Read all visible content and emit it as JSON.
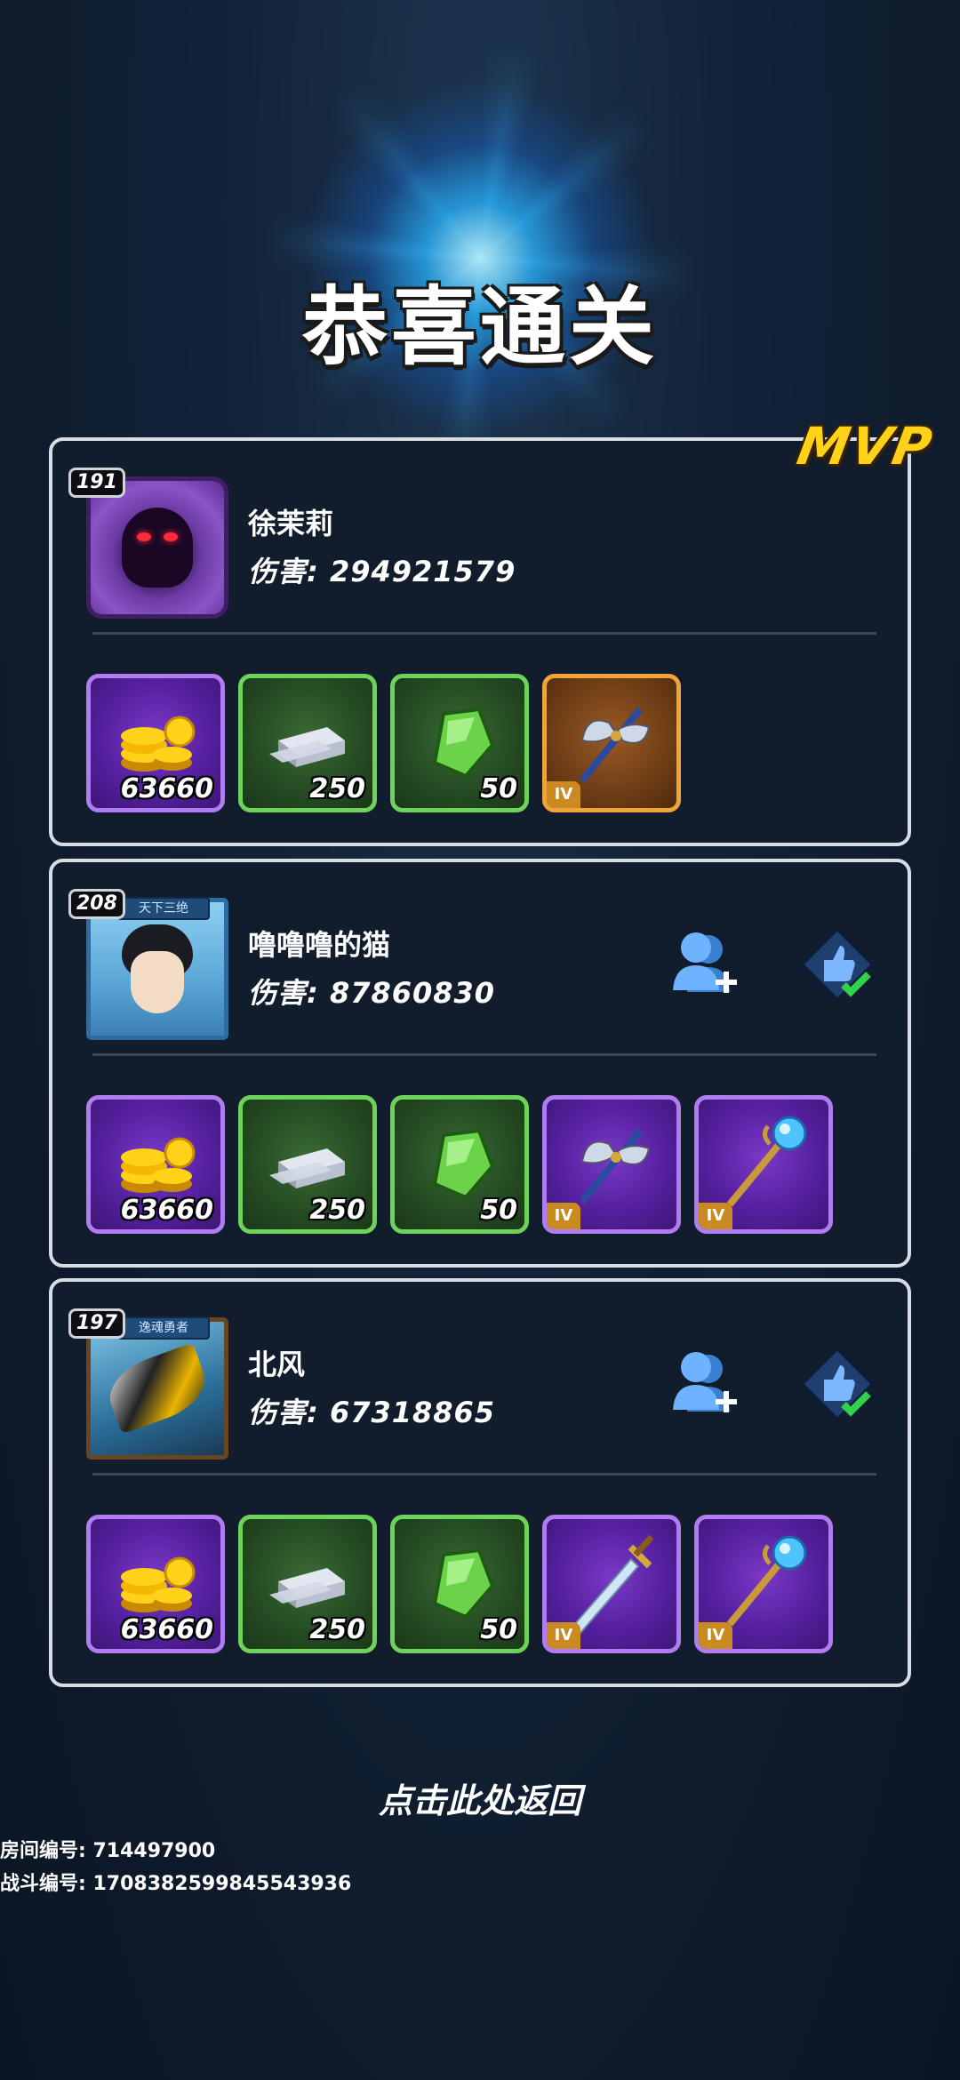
{
  "title": "恭喜通关",
  "mvp_label": "MVP",
  "players": [
    {
      "level": "191",
      "name": "徐茉莉",
      "damage": "伤害: 294921579",
      "items": [
        {
          "kind": "gold",
          "qty": "63660",
          "rarity": "purple"
        },
        {
          "kind": "silver-ingot",
          "qty": "250",
          "rarity": "green"
        },
        {
          "kind": "green-gem",
          "qty": "50",
          "rarity": "green"
        },
        {
          "kind": "axe",
          "tier": "IV",
          "rarity": "orange"
        }
      ]
    },
    {
      "level": "208",
      "avatar_banner": "天下三绝",
      "name": "噜噜噜的猫",
      "damage": "伤害: 87860830",
      "items": [
        {
          "kind": "gold",
          "qty": "63660",
          "rarity": "purple"
        },
        {
          "kind": "silver-ingot",
          "qty": "250",
          "rarity": "green"
        },
        {
          "kind": "green-gem",
          "qty": "50",
          "rarity": "green"
        },
        {
          "kind": "axe",
          "tier": "IV",
          "rarity": "purple"
        },
        {
          "kind": "staff",
          "tier": "IV",
          "rarity": "purple"
        }
      ]
    },
    {
      "level": "197",
      "avatar_banner": "逸魂勇者",
      "name": "北风",
      "damage": "伤害: 67318865",
      "items": [
        {
          "kind": "gold",
          "qty": "63660",
          "rarity": "purple"
        },
        {
          "kind": "silver-ingot",
          "qty": "250",
          "rarity": "green"
        },
        {
          "kind": "green-gem",
          "qty": "50",
          "rarity": "green"
        },
        {
          "kind": "sword",
          "tier": "IV",
          "rarity": "purple"
        },
        {
          "kind": "staff",
          "tier": "IV",
          "rarity": "purple"
        }
      ]
    }
  ],
  "back_label": "点击此处返回",
  "room_id": "房间编号: 714497900",
  "battle_id": "战斗编号: 1708382599845543936",
  "colors": {
    "mvp": "#ffd21a",
    "purple_border": "#b07cf0",
    "green_border": "#6ed35a",
    "orange_border": "#f0a43a"
  }
}
